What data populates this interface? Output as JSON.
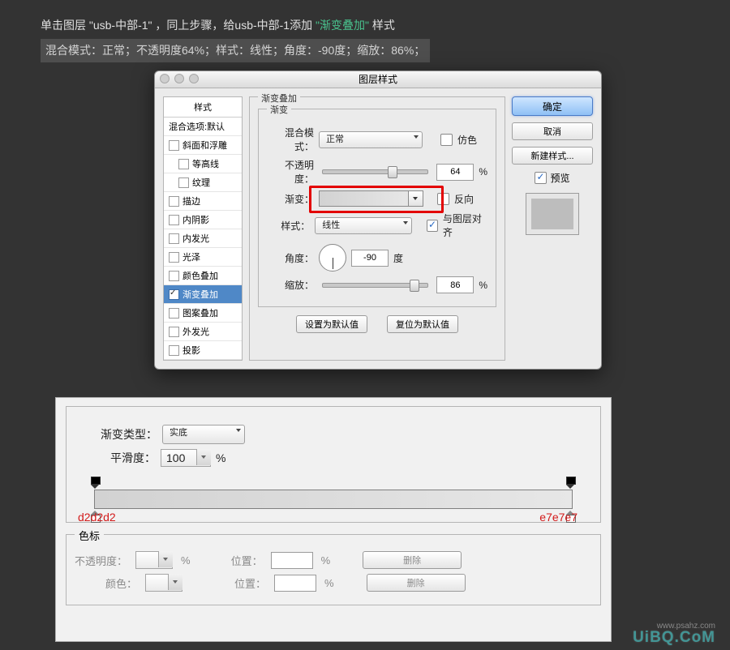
{
  "instructions": {
    "line1_pre": "单击图层",
    "line1_quote": "\"usb-中部-1\"",
    "line1_mid": "，同上步骤，给usb-中部-1添加",
    "line1_hl": "\"渐变叠加\"",
    "line1_post": "样式",
    "line2": "混合模式：正常；不透明度64%；样式：线性；角度：-90度；缩放：86%；"
  },
  "dialog": {
    "title": "图层样式",
    "stylelist": {
      "head": "样式",
      "blend": "混合选项:默认",
      "items": [
        "斜面和浮雕",
        "等高线",
        "纹理",
        "描边",
        "内阴影",
        "内发光",
        "光泽",
        "颜色叠加",
        "渐变叠加",
        "图案叠加",
        "外发光",
        "投影"
      ],
      "selected": "渐变叠加"
    },
    "center": {
      "fieldset": "渐变叠加",
      "inner": "渐变",
      "blendmode_lbl": "混合模式：",
      "blendmode_val": "正常",
      "dither_lbl": "仿色",
      "opacity_lbl": "不透明度：",
      "opacity_val": "64",
      "percent": "%",
      "gradient_lbl": "渐变：",
      "reverse_lbl": "反向",
      "style_lbl": "样式：",
      "style_val": "线性",
      "align_lbl": "与图层对齐",
      "angle_lbl": "角度：",
      "angle_val": "-90",
      "degree": "度",
      "scale_lbl": "缩放：",
      "scale_val": "86",
      "default_btn": "设置为默认值",
      "reset_btn": "复位为默认值"
    },
    "right": {
      "ok": "确定",
      "cancel": "取消",
      "newstyle": "新建样式...",
      "preview": "预览"
    }
  },
  "gradientEditor": {
    "type_lbl": "渐变类型：",
    "type_val": "实底",
    "smooth_lbl": "平滑度：",
    "smooth_val": "100",
    "percent": "%",
    "leftHex": "d2d2d2",
    "rightHex": "e7e7e7",
    "stops_label": "色标",
    "row_opacity": "不透明度：",
    "row_pos": "位置：",
    "row_color": "颜色：",
    "delete": "删除"
  },
  "watermark": "UiBQ.CoM",
  "watermark2": "www.psahz.com"
}
